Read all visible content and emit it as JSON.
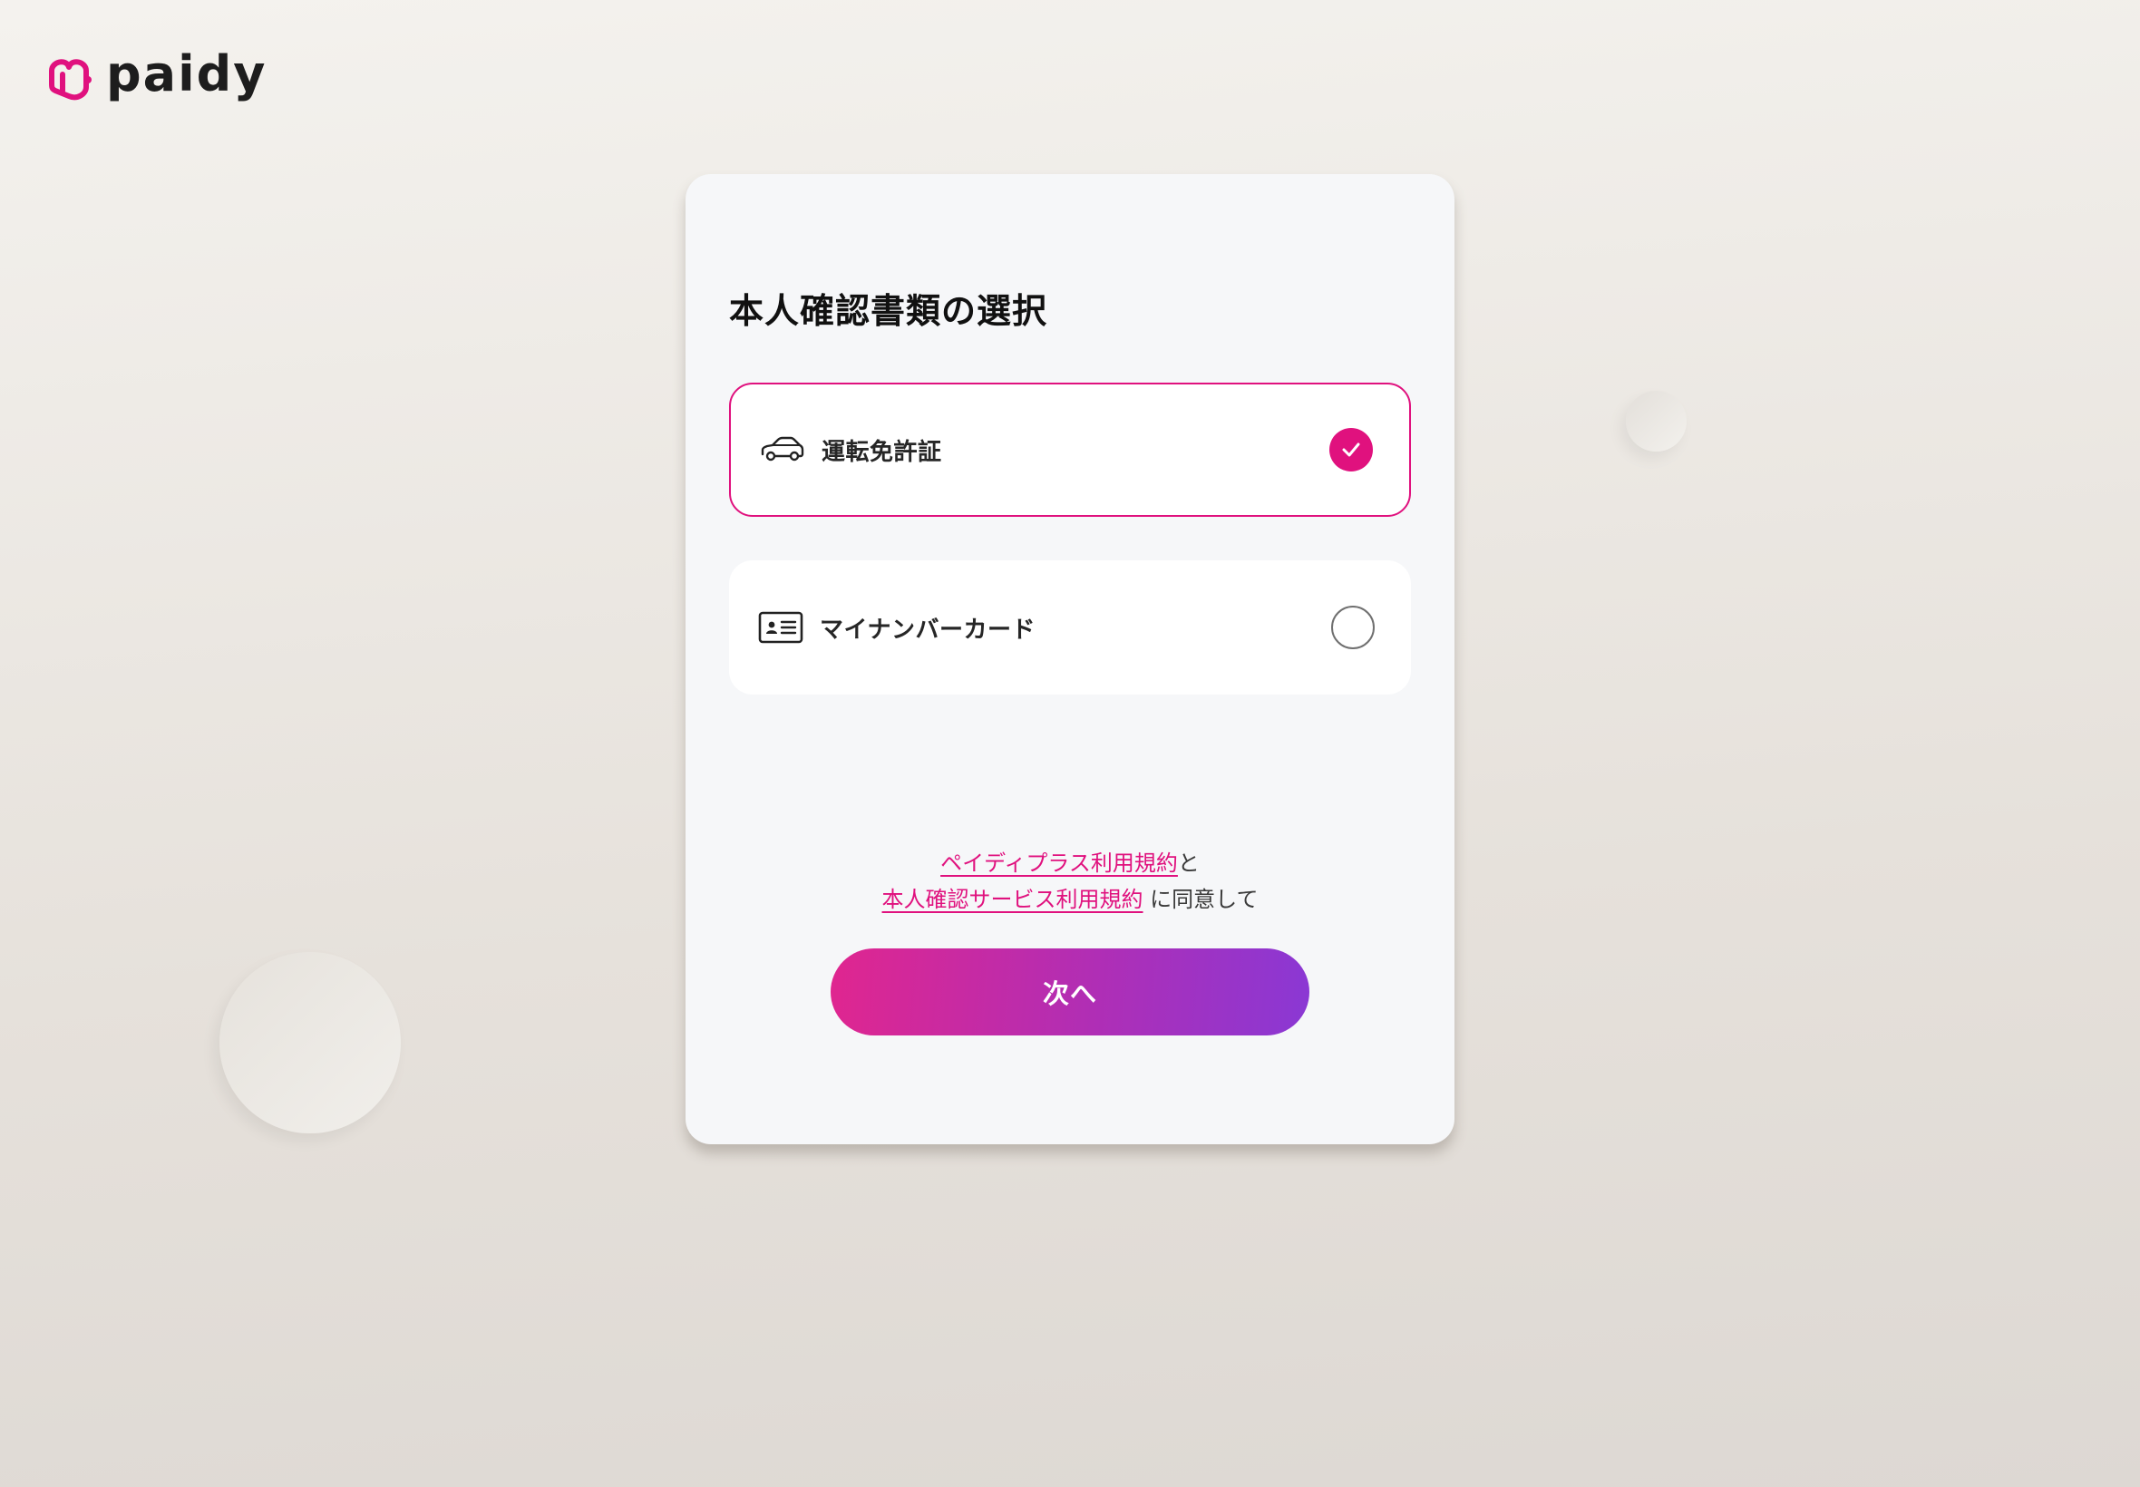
{
  "brand": {
    "name": "paidy",
    "logo_color": "#e0117e"
  },
  "card": {
    "title": "本人確認書類の選択",
    "options": [
      {
        "label": "運転免許証",
        "icon": "car-icon",
        "selected": true
      },
      {
        "label": "マイナンバーカード",
        "icon": "id-card-icon",
        "selected": false
      }
    ],
    "terms": {
      "link1": "ペイディプラス利用規約",
      "connector": "と",
      "link2": "本人確認サービス利用規約",
      "suffix": " に同意して"
    },
    "next_button_label": "次へ"
  },
  "colors": {
    "accent": "#e0117e",
    "button_gradient_start": "#e0268f",
    "button_gradient_end": "#8a38d4",
    "card_bg": "#f6f7f9"
  }
}
